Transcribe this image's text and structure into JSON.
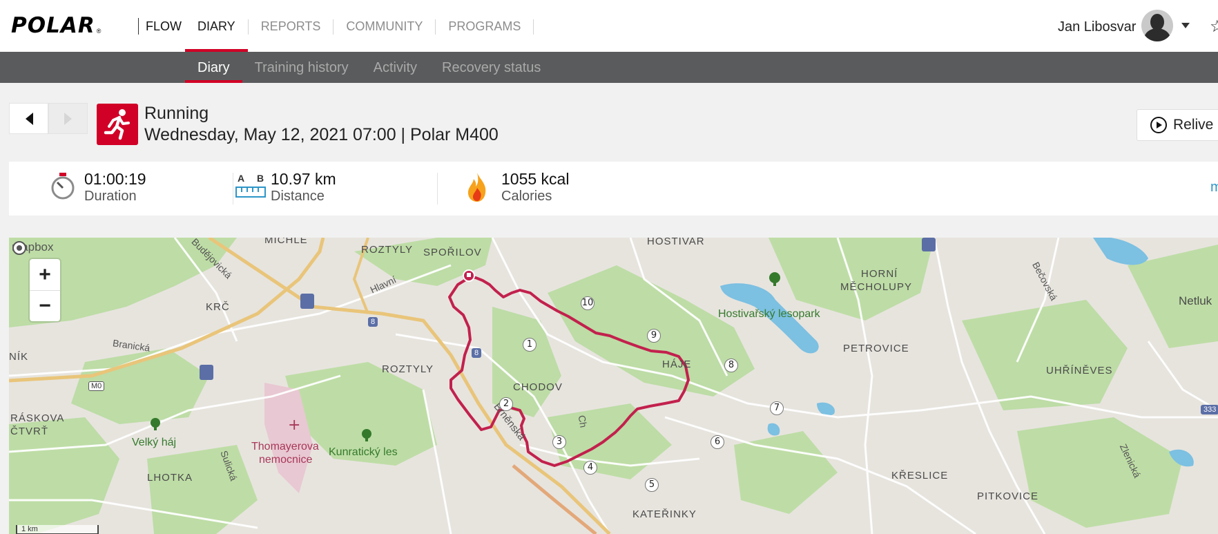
{
  "header": {
    "logo_text": "POLAR",
    "logo_reg": "®",
    "product": "FLOW",
    "nav": [
      "DIARY",
      "REPORTS",
      "COMMUNITY",
      "PROGRAMS"
    ],
    "user_name": "Jan Libosvar"
  },
  "subnav": [
    "Diary",
    "Training history",
    "Activity",
    "Recovery status"
  ],
  "activity": {
    "sport": "Running",
    "date_line": "Wednesday, May 12, 2021 07:00 | Polar M400",
    "relive_label": "Relive"
  },
  "summary": {
    "duration": {
      "value": "01:00:19",
      "label": "Duration"
    },
    "distance": {
      "value": "10.97 km",
      "label": "Distance",
      "icon_a": "A",
      "icon_b": "B"
    },
    "calories": {
      "value": "1055 kcal",
      "label": "Calories"
    },
    "more": "m"
  },
  "map": {
    "attribution": "mapbox",
    "zoom_in": "+",
    "zoom_out": "−",
    "scale": "1 km",
    "labels": {
      "michle": "MICHLE",
      "roztyly_top": "ROZTYLY",
      "sporilov": "SPOŘILOV",
      "hostivar": "HOSTIVAŘ",
      "horni_mecholupy": "HORNÍ",
      "horni_mecholupy_2": "MĚCHOLUPY",
      "krc": "KRČ",
      "hlavni": "Hlavní",
      "budejovicka": "Budějovická",
      "branicka": "Branická",
      "nik": "NÍK",
      "roztyly": "ROZTYLY",
      "chodov": "CHODOV",
      "haje": "HÁJE",
      "petrovice": "PETROVICE",
      "uhrineves": "UHŘÍNĚVES",
      "netluky": "Netluk",
      "becovska": "Bečovská",
      "raskova": "RÁSKOVA",
      "ctvrt": "ČTVRŤ",
      "velky_haj": "Velký háj",
      "thomayerova": "Thomayerova",
      "nemocnice": "nemocnice",
      "kunraticky_les": "Kunratický les",
      "lhotka": "LHOTKA",
      "sulicka": "Sulická",
      "brnenska": "Brněnská",
      "kreslice": "KŘESLICE",
      "pitkovice": "PITKOVICE",
      "zlenicka": "Zlenická",
      "katerinky": "KATEŘINKY",
      "hostivarsky_lesopark": "Hostivařský lesopark",
      "chodovska": "Ch"
    },
    "badges": {
      "m0": "M0",
      "r8a": "8",
      "r8b": "8",
      "r333": "333"
    },
    "km_markers": [
      "1",
      "2",
      "3",
      "4",
      "5",
      "6",
      "7",
      "8",
      "9",
      "10"
    ]
  },
  "colors": {
    "brand_red": "#d10027",
    "subnav_bg": "#5a5b5c",
    "route": "#c2214d",
    "link_blue": "#2c95c8"
  }
}
